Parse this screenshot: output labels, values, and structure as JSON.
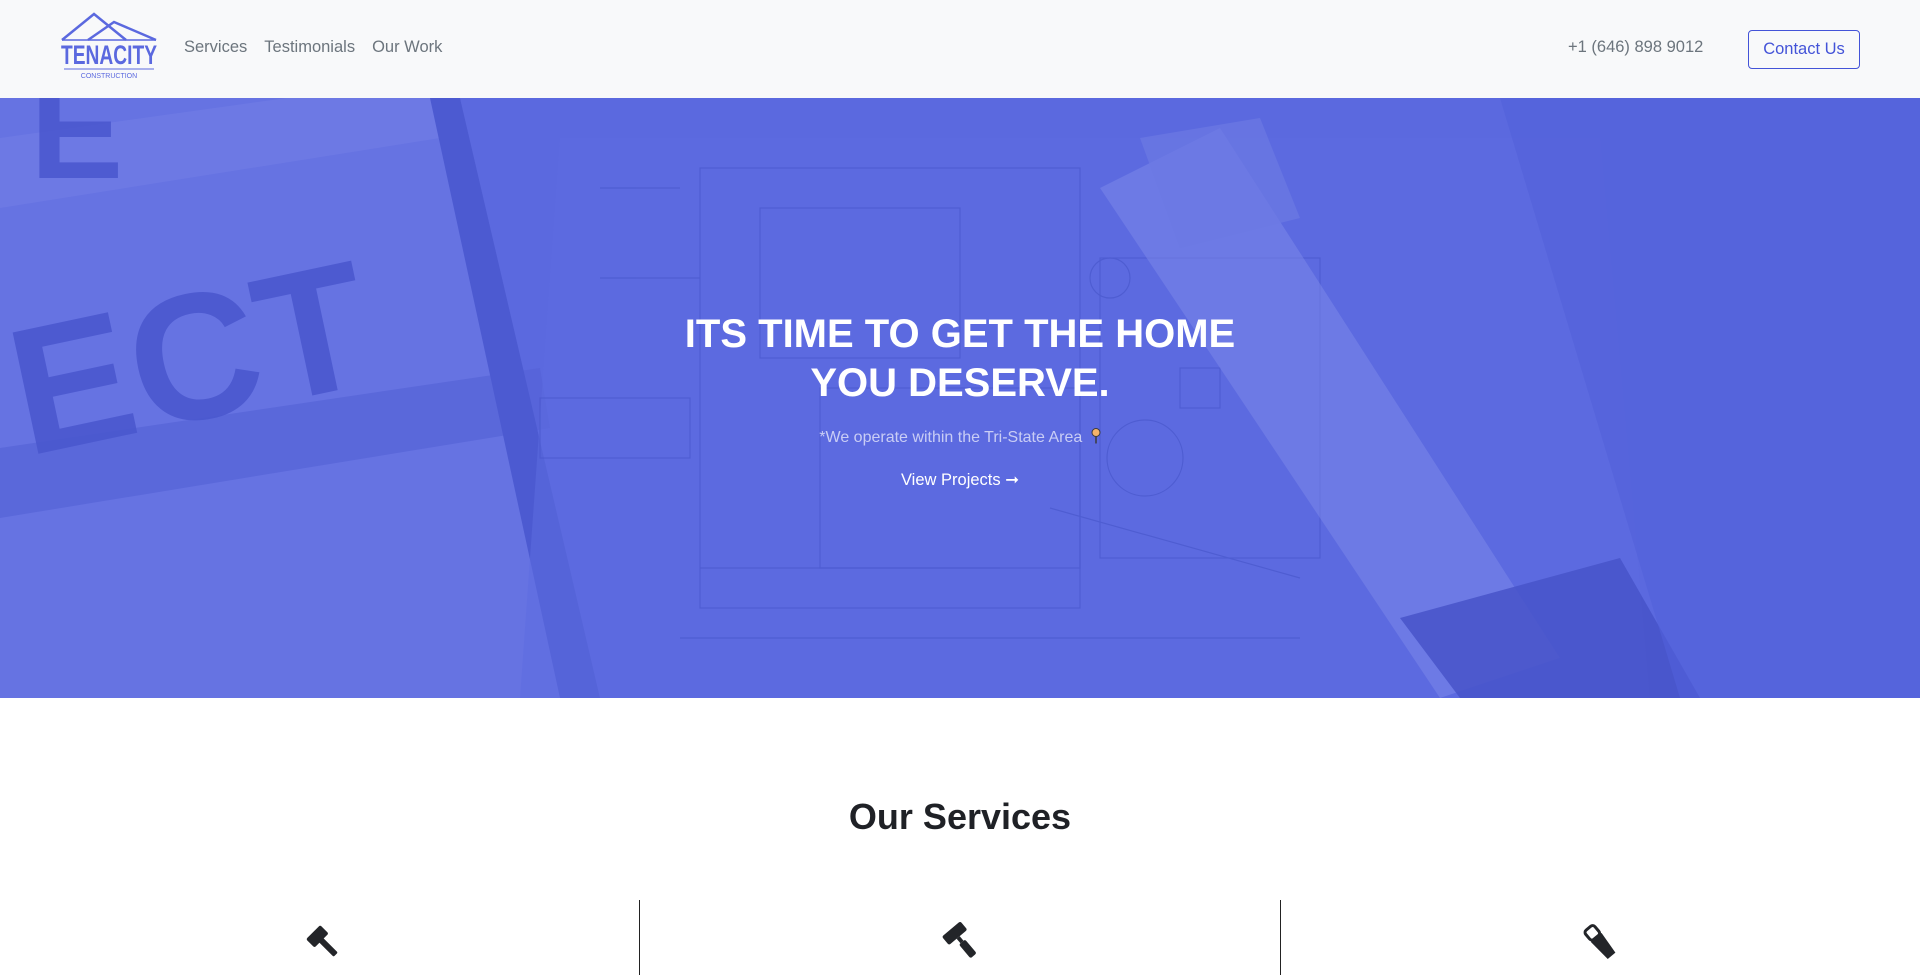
{
  "brand": {
    "name": "TENACITY",
    "tagline": "CONSTRUCTION",
    "color": "#5b69df"
  },
  "nav": {
    "links": [
      {
        "label": "Services"
      },
      {
        "label": "Testimonials"
      },
      {
        "label": "Our Work"
      }
    ],
    "phone": "+1 (646) 898 9012",
    "contact_label": "Contact Us"
  },
  "hero": {
    "title_line1": "ITS TIME TO GET THE HOME",
    "title_line2": "YOU DESERVE.",
    "note": "*We operate within the Tri-State Area",
    "note_icon": "map-pin-icon",
    "cta_label": "View Projects ➞",
    "overlay_color": "#5b69df"
  },
  "services": {
    "title": "Our Services",
    "highlight_color": "#fde2a0",
    "icons": [
      "hammer-icon",
      "paint-roller-icon",
      "saw-icon"
    ]
  }
}
